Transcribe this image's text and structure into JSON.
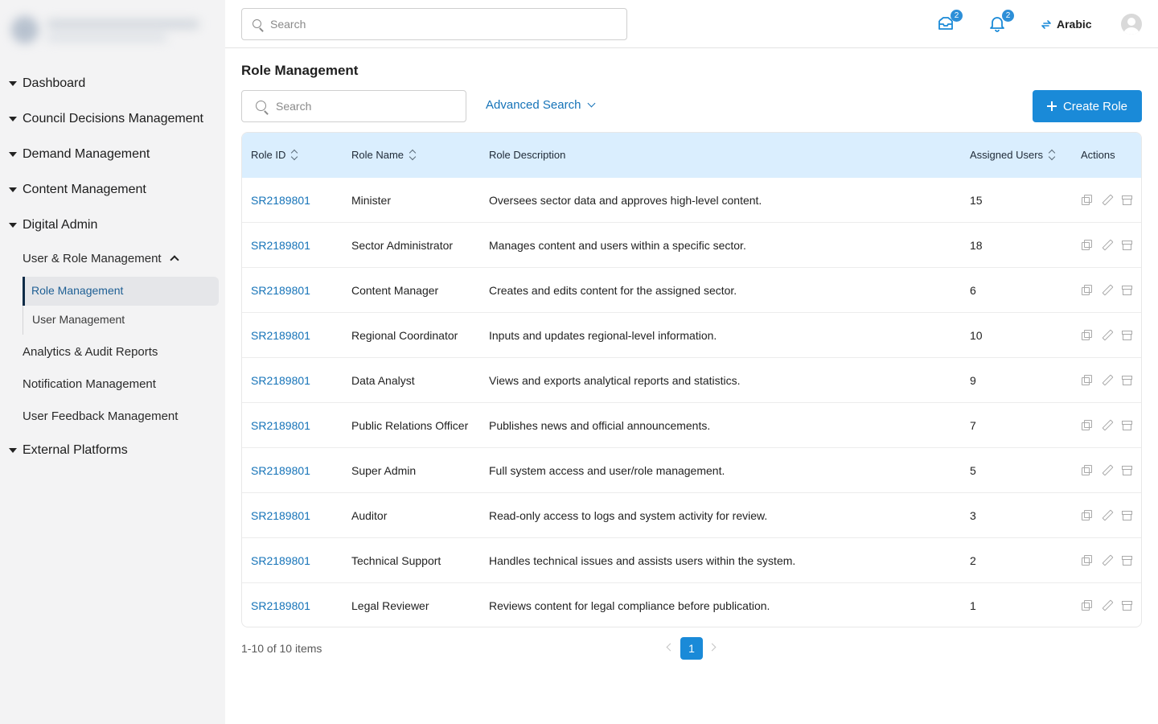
{
  "header": {
    "search_placeholder": "Search",
    "messages_badge": "2",
    "notifications_badge": "2",
    "language_label": "Arabic"
  },
  "sidebar": {
    "items": [
      {
        "label": "Dashboard"
      },
      {
        "label": "Council Decisions Management"
      },
      {
        "label": "Demand Management"
      },
      {
        "label": "Content Management"
      },
      {
        "label": "Digital Admin"
      }
    ],
    "digital_admin": {
      "user_role_label": "User & Role Management",
      "role_management_label": "Role Management",
      "user_management_label": "User Management",
      "analytics_label": "Analytics & Audit Reports",
      "notification_label": "Notification Management",
      "feedback_label": "User Feedback Management"
    },
    "external_label": "External Platforms"
  },
  "main": {
    "title": "Role Management",
    "filter_search_placeholder": "Search",
    "advanced_search_label": "Advanced Search",
    "create_button_label": "Create Role"
  },
  "table": {
    "headers": {
      "role_id": "Role ID",
      "role_name": "Role Name",
      "role_description": "Role Description",
      "assigned_users": "Assigned Users",
      "actions": "Actions"
    },
    "rows": [
      {
        "id": "SR2189801",
        "name": "Minister",
        "description": "Oversees sector data and approves high-level content.",
        "users": "15"
      },
      {
        "id": "SR2189801",
        "name": "Sector Administrator",
        "description": "Manages content and users within a specific sector.",
        "users": "18"
      },
      {
        "id": "SR2189801",
        "name": "Content Manager",
        "description": "Creates and edits content for the assigned sector.",
        "users": "6"
      },
      {
        "id": "SR2189801",
        "name": "Regional Coordinator",
        "description": "Inputs and updates regional-level information.",
        "users": "10"
      },
      {
        "id": "SR2189801",
        "name": "Data Analyst",
        "description": "Views and exports analytical reports and statistics.",
        "users": "9"
      },
      {
        "id": "SR2189801",
        "name": "Public Relations Officer",
        "description": "Publishes news and official announcements.",
        "users": "7"
      },
      {
        "id": "SR2189801",
        "name": "Super Admin",
        "description": "Full system access and user/role management.",
        "users": "5"
      },
      {
        "id": "SR2189801",
        "name": "Auditor",
        "description": "Read-only access to logs and system activity for review.",
        "users": "3"
      },
      {
        "id": "SR2189801",
        "name": "Technical Support",
        "description": "Handles technical issues and assists users within the system.",
        "users": "2"
      },
      {
        "id": "SR2189801",
        "name": "Legal Reviewer",
        "description": "Reviews content for legal compliance before publication.",
        "users": "1"
      }
    ]
  },
  "pagination": {
    "summary": "1-10 of 10 items",
    "current_page": "1"
  },
  "colors": {
    "accent": "#1a8ad8",
    "link": "#1573b8",
    "table_header_bg": "#daeefe",
    "sidebar_bg": "#f3f3f4",
    "active_indicator": "#0f2b47"
  },
  "icons": [
    "search-icon",
    "mail-icon",
    "bell-icon",
    "swap-icon",
    "user-avatar-icon",
    "copy-icon",
    "edit-icon",
    "delete-icon",
    "sort-icon",
    "chevron-down-icon",
    "chevron-up-icon",
    "caret-down-icon",
    "plus-icon",
    "chevron-left-icon",
    "chevron-right-icon"
  ]
}
